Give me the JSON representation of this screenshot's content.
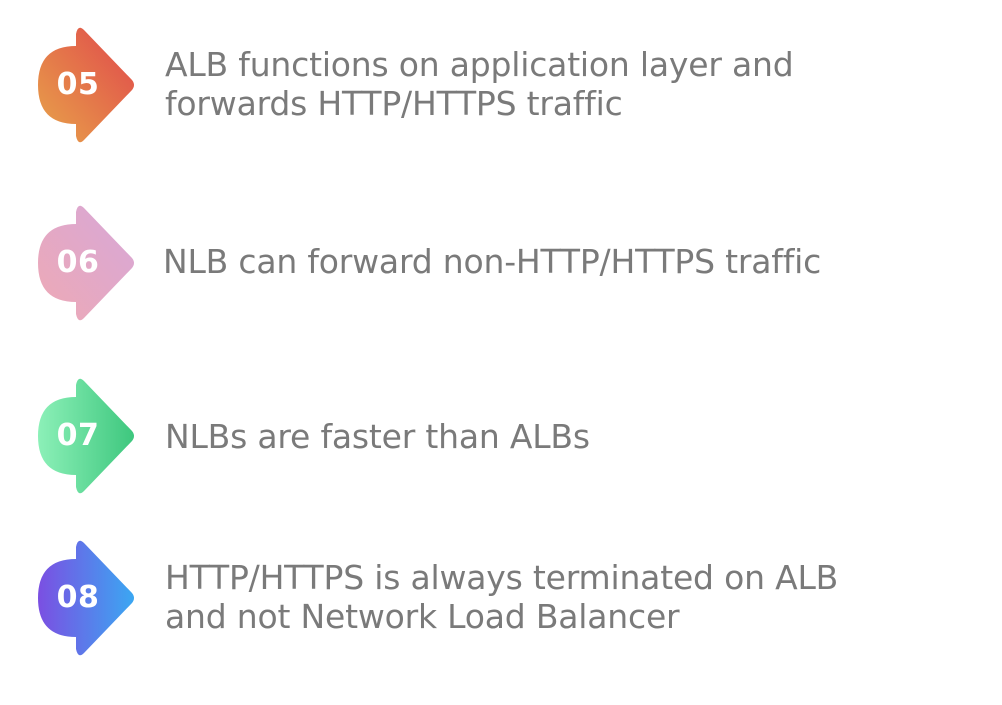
{
  "items": [
    {
      "number": "05",
      "lines": [
        "ALB functions on application layer and",
        "forwards HTTP/HTTPS traffic"
      ],
      "gradient": [
        "#e8a44a",
        "#e0474b"
      ]
    },
    {
      "number": "06",
      "lines": [
        "NLB can forward non-HTTP/HTTPS traffic"
      ],
      "gradient": [
        "#eea9b5",
        "#d7a8d8"
      ]
    },
    {
      "number": "07",
      "lines": [
        "NLBs are faster than ALBs"
      ],
      "gradient": [
        "#8cf0b8",
        "#3ec77e"
      ]
    },
    {
      "number": "08",
      "lines": [
        "HTTP/HTTPS is always terminated on ALB",
        "and not Network Load Balancer"
      ],
      "gradient": [
        "#7b4fe2",
        "#3ba7f2"
      ]
    }
  ]
}
